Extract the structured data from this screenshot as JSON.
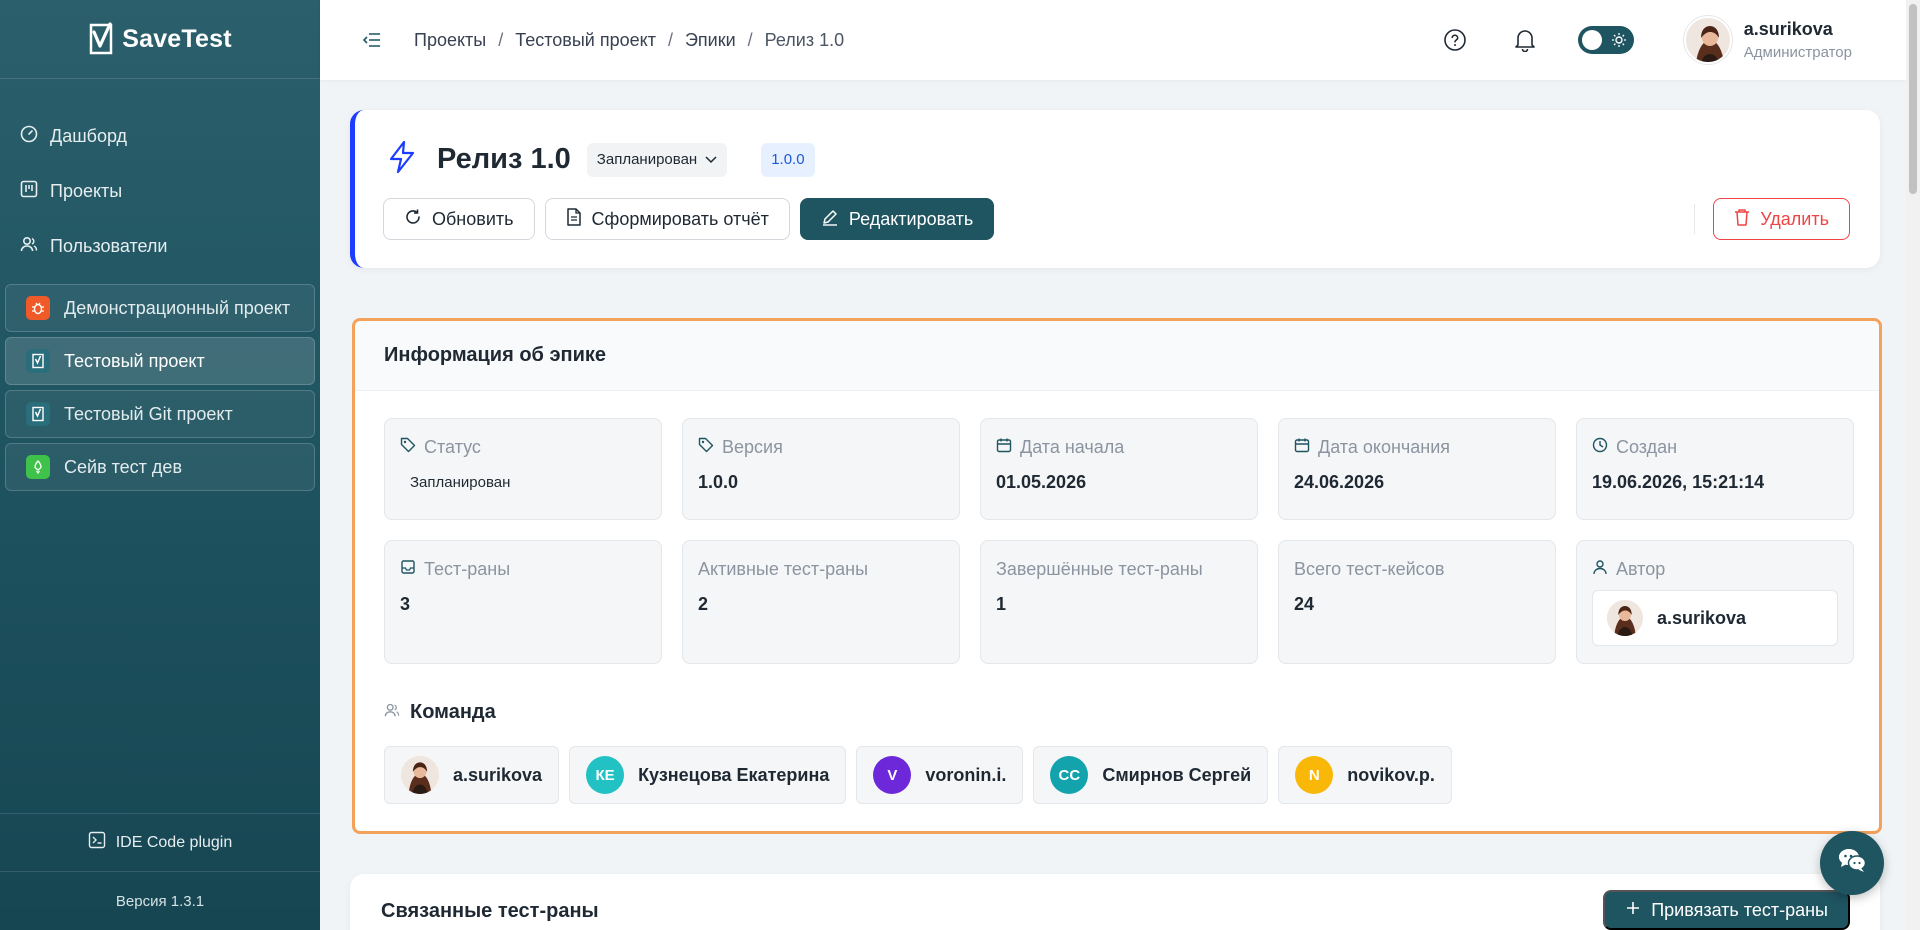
{
  "app": {
    "logo_text": "SaveTest"
  },
  "sidebar": {
    "nav": [
      {
        "label": "Дашборд",
        "icon": "dashboard-icon"
      },
      {
        "label": "Проекты",
        "icon": "kanban-icon"
      },
      {
        "label": "Пользователи",
        "icon": "users-icon"
      }
    ],
    "projects": [
      {
        "label": "Демонстрационный проект",
        "icon": "bug-icon",
        "color": "#f05a28"
      },
      {
        "label": "Тестовый проект",
        "icon": "checklist-icon",
        "color": "#2a6e7c",
        "active": true
      },
      {
        "label": "Тестовый Git проект",
        "icon": "checklist-icon",
        "color": "#2a6e7c"
      },
      {
        "label": "Сейв тест дев",
        "icon": "rocket-icon",
        "color": "#3ec24a"
      }
    ],
    "ide_label": "IDE Code plugin",
    "version": "Версия 1.3.1"
  },
  "header": {
    "breadcrumb": [
      "Проекты",
      "Тестовый проект",
      "Эпики",
      "Релиз 1.0"
    ],
    "user_name": "a.surikova",
    "user_role": "Администратор"
  },
  "epic": {
    "title": "Релиз 1.0",
    "status": "Запланирован",
    "version": "1.0.0",
    "buttons": {
      "refresh": "Обновить",
      "report": "Сформировать отчёт",
      "edit": "Редактировать",
      "delete": "Удалить"
    }
  },
  "info": {
    "title": "Информация об эпике",
    "cells": [
      {
        "label": "Статус",
        "value": "Запланирован"
      },
      {
        "label": "Версия",
        "value": "1.0.0"
      },
      {
        "label": "Дата начала",
        "value": "01.05.2026"
      },
      {
        "label": "Дата окончания",
        "value": "24.06.2026"
      },
      {
        "label": "Создан",
        "value": "19.06.2026, 15:21:14"
      },
      {
        "label": "Тест-раны",
        "value": "3"
      },
      {
        "label": "Активные тест-раны",
        "value": "2"
      },
      {
        "label": "Завершённые тест-раны",
        "value": "1"
      },
      {
        "label": "Всего тест-кейсов",
        "value": "24"
      },
      {
        "label": "Автор",
        "value": "a.surikova"
      }
    ],
    "team_title": "Команда",
    "team": [
      {
        "name": "a.surikova",
        "initials": "",
        "color": "#efe6df"
      },
      {
        "name": "Кузнецова Екатерина",
        "initials": "КЕ",
        "color": "#22c1c3"
      },
      {
        "name": "voronin.i.",
        "initials": "V",
        "color": "#6d28d9"
      },
      {
        "name": "Смирнов Сергей",
        "initials": "СС",
        "color": "#13a3ad"
      },
      {
        "name": "novikov.p.",
        "initials": "N",
        "color": "#f9b707"
      }
    ]
  },
  "linked": {
    "title": "Связанные тест-раны",
    "attach_button": "Привязать тест-раны"
  }
}
